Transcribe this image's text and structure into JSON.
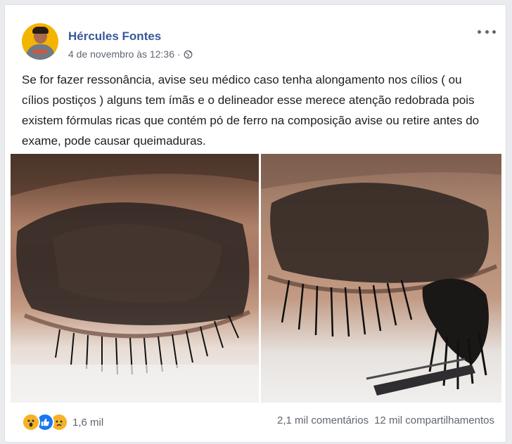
{
  "post": {
    "author": "Hércules Fontes",
    "date": "4 de novembro às 12:36",
    "separator": "·",
    "privacy_icon": "globe-icon",
    "more_icon": "more-options-icon",
    "text": "Se for fazer ressonância, avise seu médico caso tenha alongamento nos cílios ( ou cílios postiços ) alguns tem ímãs e o delineador esse merece atenção redobrada pois existem fórmulas ricas que contém pó de ferro na composição avise ou retire antes do exame, pode causar queimaduras."
  },
  "photos": [
    {
      "name": "photo-eyelid-closed-eye",
      "description_icon": "photo"
    },
    {
      "name": "photo-eyelid-lashes-tweezers",
      "description_icon": "photo"
    }
  ],
  "footer": {
    "reaction_icons": [
      "wow-reaction-icon",
      "like-reaction-icon",
      "sad-reaction-icon"
    ],
    "reactions_count": "1,6 mil",
    "comments": "2,1 mil comentários",
    "shares": "12 mil compartilhamentos"
  },
  "colors": {
    "link_blue": "#385898",
    "secondary_text": "#606770",
    "like_blue": "#1877f2",
    "reaction_yellow": "#f7b125"
  }
}
